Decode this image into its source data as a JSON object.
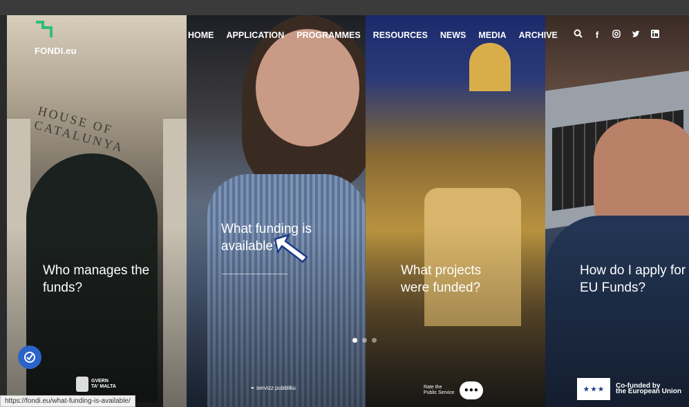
{
  "browser": {
    "url_partial": "https://fondi.eu"
  },
  "site": {
    "logo_text": "FONDI.eu"
  },
  "nav": {
    "items": [
      "HOME",
      "APPLICATION",
      "PROGRAMMES",
      "RESOURCES",
      "NEWS",
      "MEDIA",
      "ARCHIVE"
    ]
  },
  "panels": [
    {
      "sign": "HOUSE OF CATALUNYA",
      "caption_l1": "Who manages the",
      "caption_l2": "funds?"
    },
    {
      "caption_l1": "What funding is",
      "caption_l2": "available?"
    },
    {
      "caption_l1": "What projects",
      "caption_l2": "were funded?"
    },
    {
      "caption_l1": "How do I apply for",
      "caption_l2": "EU Funds?"
    }
  ],
  "footer": {
    "gvern_l1": "GVERN",
    "gvern_l2": "TA' MALTA",
    "servizz": "servizz pubbliku",
    "rate_l1": "Rate the",
    "rate_l2": "Public Service",
    "eu_l1": "Co-funded by",
    "eu_l2": "the European Union"
  },
  "status_bar": {
    "url": "https://fondi.eu/what-funding-is-available/"
  },
  "slider": {
    "dots": 3,
    "active_index": 0
  },
  "colors": {
    "accent_green": "#2fbf71",
    "a11y_blue": "#2b63c9"
  }
}
